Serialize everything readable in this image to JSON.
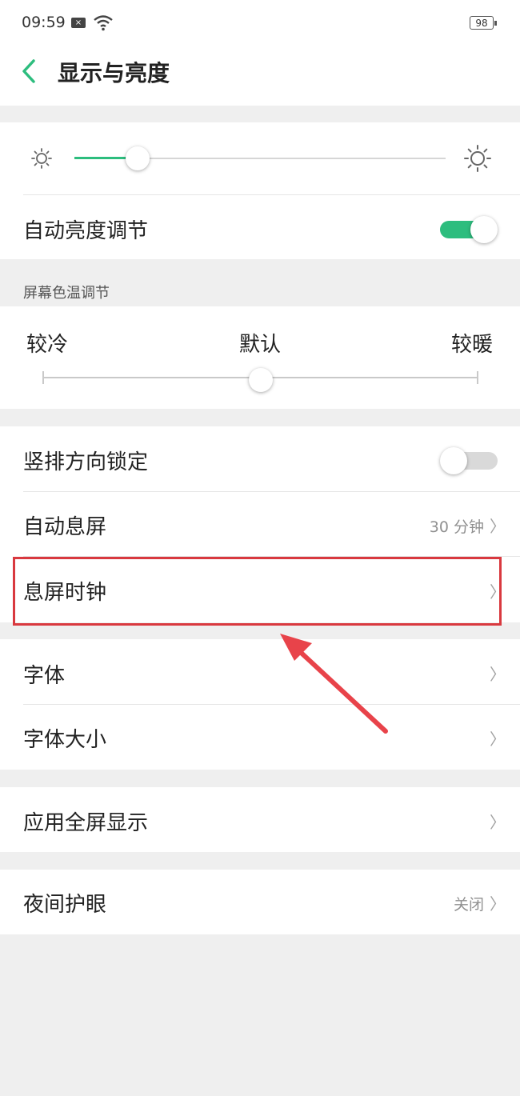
{
  "status_bar": {
    "time": "09:59",
    "battery": "98"
  },
  "header": {
    "title": "显示与亮度"
  },
  "brightness": {
    "level": 0.17,
    "auto_label": "自动亮度调节",
    "auto_enabled": true
  },
  "color_temp": {
    "section_label": "屏幕色温调节",
    "cold_label": "较冷",
    "default_label": "默认",
    "warm_label": "较暖",
    "level": 0.5
  },
  "orientation": {
    "label": "竖排方向锁定",
    "enabled": false
  },
  "auto_sleep": {
    "label": "自动息屏",
    "value": "30 分钟"
  },
  "sleep_clock": {
    "label": "息屏时钟"
  },
  "font": {
    "label": "字体"
  },
  "font_size": {
    "label": "字体大小"
  },
  "fullscreen": {
    "label": "应用全屏显示"
  },
  "night_mode": {
    "label": "夜间护眼",
    "value": "关闭"
  },
  "colors": {
    "accent": "#2dbd7e",
    "highlight": "#d9393f",
    "arrow": "#e8434a"
  },
  "icons": {
    "back": "chevron-left-icon",
    "sun": "sun-icon",
    "chevron": "chevron-right-icon"
  }
}
